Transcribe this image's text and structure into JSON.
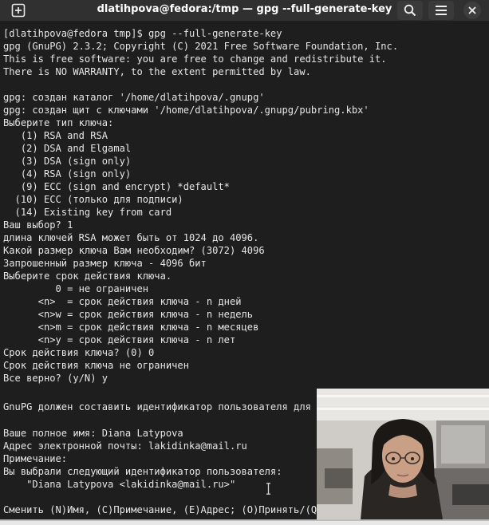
{
  "window": {
    "title": "dlatihpova@fedora:/tmp — gpg --full-generate-key"
  },
  "icons": {
    "new_tab": "new-tab-icon",
    "search": "search-icon",
    "menu": "hamburger-menu-icon",
    "close": "close-icon"
  },
  "terminal": {
    "lines": [
      "[dlatihpova@fedora tmp]$ gpg --full-generate-key",
      "gpg (GnuPG) 2.3.2; Copyright (C) 2021 Free Software Foundation, Inc.",
      "This is free software: you are free to change and redistribute it.",
      "There is NO WARRANTY, to the extent permitted by law.",
      "",
      "gpg: создан каталог '/home/dlatihpova/.gnupg'",
      "gpg: создан щит с ключами '/home/dlatihpova/.gnupg/pubring.kbx'",
      "Выберите тип ключа:",
      "   (1) RSA and RSA",
      "   (2) DSA and Elgamal",
      "   (3) DSA (sign only)",
      "   (4) RSA (sign only)",
      "   (9) ECC (sign and encrypt) *default*",
      "  (10) ECC (только для подписи)",
      "  (14) Existing key from card",
      "Ваш выбор? 1",
      "длина ключей RSA может быть от 1024 до 4096.",
      "Какой размер ключа Вам необходим? (3072) 4096",
      "Запрошенный размер ключа - 4096 бит",
      "Выберите срок действия ключа.",
      "         0 = не ограничен",
      "      <n>  = срок действия ключа - n дней",
      "      <n>w = срок действия ключа - n недель",
      "      <n>m = срок действия ключа - n месяцев",
      "      <n>y = срок действия ключа - n лет",
      "Срок действия ключа? (0) 0",
      "Срок действия ключа не ограничен",
      "Все верно? (y/N) y",
      "",
      "GnuPG должен составить идентификатор пользователя для и",
      "",
      "Ваше полное имя: Diana Latypova",
      "Адрес электронной почты: lakidinka@mail.ru",
      "Примечание:",
      "Вы выбрали следующий идентификатор пользователя:",
      "    \"Diana Latypova <lakidinka@mail.ru>\"",
      "",
      "Сменить (N)Имя, (C)Примечание, (E)Адрес; (O)Принять/(Q)"
    ]
  }
}
